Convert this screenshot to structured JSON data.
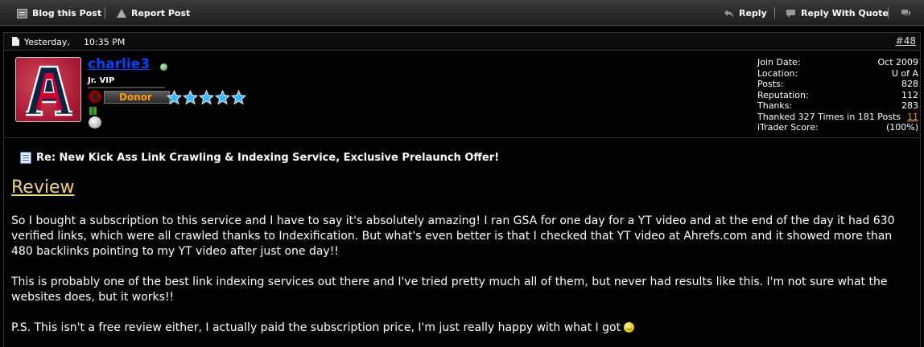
{
  "toolbar": {
    "blog_label": "Blog this Post",
    "report_label": "Report Post",
    "reply_label": "Reply",
    "quote_label": "Reply With Quote"
  },
  "post": {
    "date": "Yesterday,",
    "time": "10:35 PM",
    "number": "#48"
  },
  "user": {
    "name": "charlie3",
    "title": "Jr. VIP",
    "donor_label": "Donor",
    "stars": 5,
    "stats": [
      {
        "label": "Join Date:",
        "value": "Oct 2009"
      },
      {
        "label": "Location:",
        "value": "U of A"
      },
      {
        "label": "Posts:",
        "value": "828"
      },
      {
        "label": "Reputation:",
        "value": "112"
      },
      {
        "label": "Thanks:",
        "value": "283"
      }
    ],
    "thanked_text": "Thanked 327 Times in 181 Posts",
    "thanked_link": "11",
    "itrader_label": "iTrader Score:",
    "itrader_value": "(100%)"
  },
  "content": {
    "title": "Re: New Kick Ass Link Crawling & Indexing Service, Exclusive Prelaunch Offer!",
    "heading": "Review",
    "paragraphs": [
      "So I bought a subscription to this service and I have to say it's absolutely amazing! I ran GSA for one day for a YT video and at the end of the day it had 630 verified links, which were all crawled thanks to Indexification. But what's even better is that I checked that YT video at Ahrefs.com and it showed more than 480 backlinks pointing to my YT video after just one day!!",
      "This is probably one of the best link indexing services out there and I've tried pretty much all of them, but never had results like this. I'm not sure what the websites does, but it works!!",
      "P.S. This isn't a free review either, I actually paid the subscription price, I'm just really happy with what I got"
    ]
  },
  "colors": {
    "username": "#0044ff",
    "donor": "#ff9c00",
    "heading": "#f0d47a",
    "star": "#3fb8ff"
  }
}
